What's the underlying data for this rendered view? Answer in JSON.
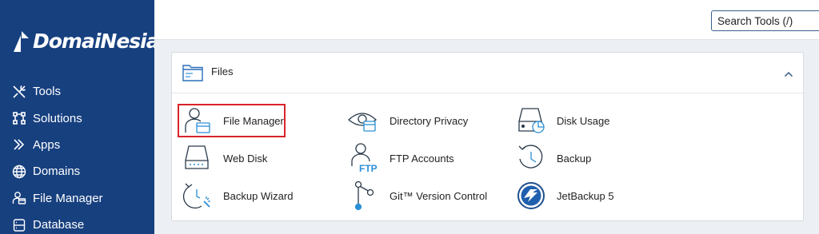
{
  "sidebar": {
    "logo_text": "DomaiNesia",
    "items": [
      {
        "label": "Tools",
        "icon": "tools-icon"
      },
      {
        "label": "Solutions",
        "icon": "solutions-icon"
      },
      {
        "label": "Apps",
        "icon": "apps-icon"
      },
      {
        "label": "Domains",
        "icon": "globe-icon"
      },
      {
        "label": "File Manager",
        "icon": "file-manager-icon"
      },
      {
        "label": "Database",
        "icon": "database-icon"
      }
    ]
  },
  "header": {
    "search_placeholder": "Search Tools (/)"
  },
  "files_panel": {
    "title": "Files",
    "expanded": true,
    "tools": [
      {
        "label": "File Manager",
        "icon": "file-manager-icon",
        "highlighted": true
      },
      {
        "label": "Directory Privacy",
        "icon": "directory-privacy-icon"
      },
      {
        "label": "Disk Usage",
        "icon": "disk-usage-icon"
      },
      {
        "label": "Web Disk",
        "icon": "web-disk-icon"
      },
      {
        "label": "FTP Accounts",
        "icon": "ftp-accounts-icon"
      },
      {
        "label": "Backup",
        "icon": "backup-icon"
      },
      {
        "label": "Backup Wizard",
        "icon": "backup-wizard-icon"
      },
      {
        "label": "Git™ Version Control",
        "icon": "git-icon"
      },
      {
        "label": "JetBackup 5",
        "icon": "jetbackup-icon"
      }
    ]
  },
  "colors": {
    "sidebar_bg": "#17407f",
    "accent": "#2a8fd6",
    "highlight": "#d9232a"
  }
}
